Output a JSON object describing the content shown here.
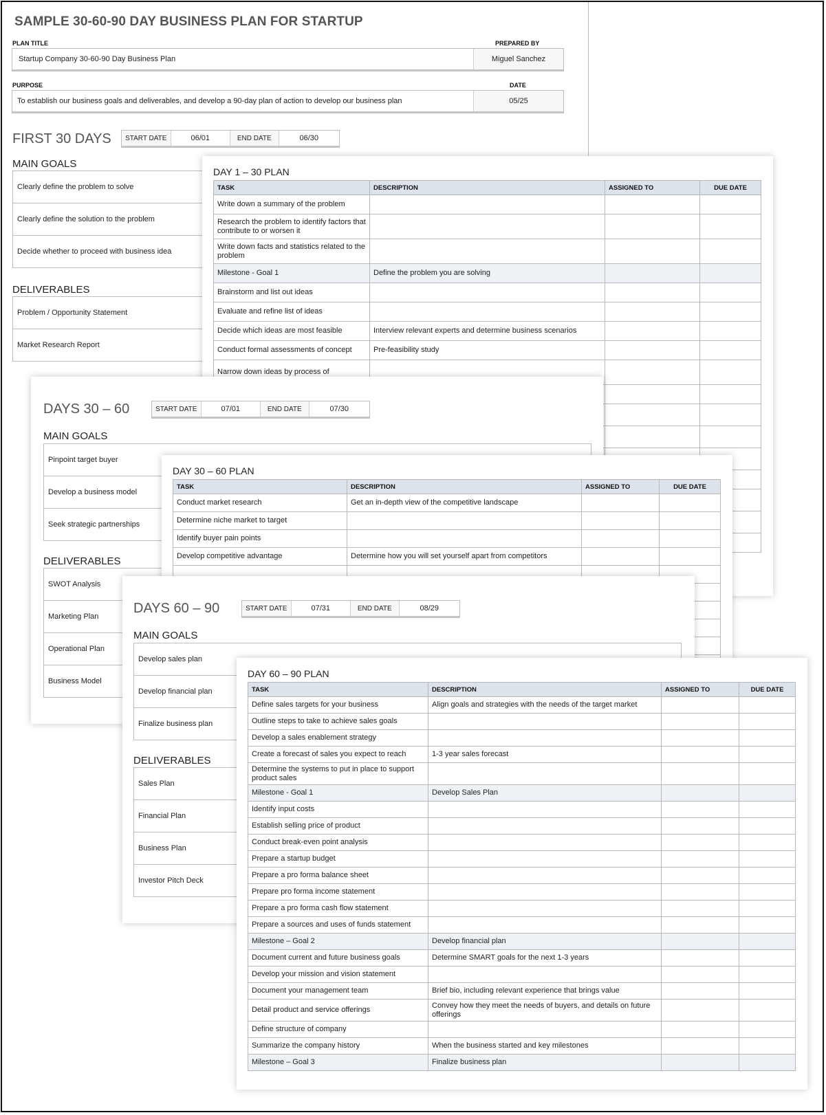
{
  "document": {
    "title": "SAMPLE 30-60-90 DAY BUSINESS PLAN FOR STARTUP",
    "plan_title_label": "PLAN TITLE",
    "plan_title_value": "Startup Company 30-60-90 Day Business Plan",
    "prepared_by_label": "PREPARED BY",
    "prepared_by_value": "Miguel Sanchez",
    "purpose_label": "PURPOSE",
    "purpose_value": "To establish our business goals and deliverables, and develop a 90-day plan of action to develop our business plan",
    "date_label": "DATE",
    "date_value": "05/25"
  },
  "labels": {
    "start_date": "START DATE",
    "end_date": "END DATE",
    "main_goals": "MAIN GOALS",
    "deliverables": "DELIVERABLES",
    "col_task": "TASK",
    "col_description": "DESCRIPTION",
    "col_assigned": "ASSIGNED TO",
    "col_due": "DUE DATE"
  },
  "periods": [
    {
      "title": "FIRST 30 DAYS",
      "start_date": "06/01",
      "end_date": "06/30",
      "main_goals": [
        "Clearly define the problem to solve",
        "Clearly define the solution to the problem",
        "Decide whether to proceed with business idea"
      ],
      "deliverables": [
        "Problem / Opportunity Statement",
        "Market Research Report"
      ],
      "plan_title": "DAY 1 – 30 PLAN",
      "tasks": [
        {
          "task": "Write down a summary of the problem",
          "description": "",
          "assigned_to": "",
          "due_date": "",
          "milestone": false
        },
        {
          "task": "Research the problem to identify factors that contribute to or worsen it",
          "description": "",
          "assigned_to": "",
          "due_date": "",
          "milestone": false
        },
        {
          "task": "Write down facts and statistics related to the problem",
          "description": "",
          "assigned_to": "",
          "due_date": "",
          "milestone": false
        },
        {
          "task": "Milestone - Goal 1",
          "description": "Define the problem you are solving",
          "assigned_to": "",
          "due_date": "",
          "milestone": true
        },
        {
          "task": "Brainstorm and list out ideas",
          "description": "",
          "assigned_to": "",
          "due_date": "",
          "milestone": false
        },
        {
          "task": "Evaluate and refine list of ideas",
          "description": "",
          "assigned_to": "",
          "due_date": "",
          "milestone": false
        },
        {
          "task": "Decide which ideas are most feasible",
          "description": "Interview relevant experts and determine business scenarios",
          "assigned_to": "",
          "due_date": "",
          "milestone": false
        },
        {
          "task": "Conduct formal assessments of concept",
          "description": "Pre-feasibility study",
          "assigned_to": "",
          "due_date": "",
          "milestone": false
        },
        {
          "task": "Narrow down ideas by process of",
          "description": "",
          "assigned_to": "",
          "due_date": "",
          "milestone": false
        }
      ]
    },
    {
      "title": "DAYS 30 – 60",
      "start_date": "07/01",
      "end_date": "07/30",
      "main_goals": [
        "Pinpoint target buyer",
        "Develop a business model",
        "Seek strategic partnerships"
      ],
      "deliverables": [
        "SWOT Analysis",
        "Marketing Plan",
        "Operational Plan",
        "Business Model"
      ],
      "plan_title": "DAY 30 – 60 PLAN",
      "tasks": [
        {
          "task": "Conduct market research",
          "description": "Get an in-depth view of the competitive landscape",
          "assigned_to": "",
          "due_date": "",
          "milestone": false
        },
        {
          "task": "Determine niche market to target",
          "description": "",
          "assigned_to": "",
          "due_date": "",
          "milestone": false
        },
        {
          "task": "Identify buyer pain points",
          "description": "",
          "assigned_to": "",
          "due_date": "",
          "milestone": false
        },
        {
          "task": "Develop competitive advantage",
          "description": "Determine how you will set yourself apart from competitors",
          "assigned_to": "",
          "due_date": "",
          "milestone": false
        }
      ]
    },
    {
      "title": "DAYS 60 – 90",
      "start_date": "07/31",
      "end_date": "08/29",
      "main_goals": [
        "Develop sales plan",
        "Develop financial plan",
        "Finalize business plan"
      ],
      "deliverables": [
        "Sales Plan",
        "Financial Plan",
        "Business Plan",
        "Investor Pitch Deck"
      ],
      "plan_title": "DAY 60 – 90 PLAN",
      "tasks": [
        {
          "task": "Define sales targets for your business",
          "description": "Align goals and strategies with the needs of the target market",
          "assigned_to": "",
          "due_date": "",
          "milestone": false
        },
        {
          "task": "Outline steps to take to achieve sales goals",
          "description": "",
          "assigned_to": "",
          "due_date": "",
          "milestone": false
        },
        {
          "task": "Develop a sales enablement strategy",
          "description": "",
          "assigned_to": "",
          "due_date": "",
          "milestone": false
        },
        {
          "task": "Create a forecast of sales you expect to reach",
          "description": "1-3 year sales forecast",
          "assigned_to": "",
          "due_date": "",
          "milestone": false
        },
        {
          "task": "Determine the systems to put in place to support product sales",
          "description": "",
          "assigned_to": "",
          "due_date": "",
          "milestone": false
        },
        {
          "task": "Milestone - Goal 1",
          "description": "Develop Sales Plan",
          "assigned_to": "",
          "due_date": "",
          "milestone": true
        },
        {
          "task": "Identify input costs",
          "description": "",
          "assigned_to": "",
          "due_date": "",
          "milestone": false
        },
        {
          "task": "Establish selling price of product",
          "description": "",
          "assigned_to": "",
          "due_date": "",
          "milestone": false
        },
        {
          "task": "Conduct break-even point analysis",
          "description": "",
          "assigned_to": "",
          "due_date": "",
          "milestone": false
        },
        {
          "task": "Prepare a startup budget",
          "description": "",
          "assigned_to": "",
          "due_date": "",
          "milestone": false
        },
        {
          "task": "Prepare a pro forma balance sheet",
          "description": "",
          "assigned_to": "",
          "due_date": "",
          "milestone": false
        },
        {
          "task": "Prepare pro forma income statement",
          "description": "",
          "assigned_to": "",
          "due_date": "",
          "milestone": false
        },
        {
          "task": "Prepare a pro forma cash flow statement",
          "description": "",
          "assigned_to": "",
          "due_date": "",
          "milestone": false
        },
        {
          "task": "Prepare a sources and uses of funds statement",
          "description": "",
          "assigned_to": "",
          "due_date": "",
          "milestone": false
        },
        {
          "task": "Milestone – Goal 2",
          "description": "Develop financial plan",
          "assigned_to": "",
          "due_date": "",
          "milestone": true
        },
        {
          "task": "Document current and future business goals",
          "description": "Determine SMART goals for the next 1-3 years",
          "assigned_to": "",
          "due_date": "",
          "milestone": false
        },
        {
          "task": "Develop your mission and vision statement",
          "description": "",
          "assigned_to": "",
          "due_date": "",
          "milestone": false
        },
        {
          "task": "Document your management team",
          "description": "Brief bio, including relevant experience that brings value",
          "assigned_to": "",
          "due_date": "",
          "milestone": false
        },
        {
          "task": "Detail product and service offerings",
          "description": "Convey how they meet the needs of buyers, and details on future offerings",
          "assigned_to": "",
          "due_date": "",
          "milestone": false
        },
        {
          "task": "Define structure of company",
          "description": "",
          "assigned_to": "",
          "due_date": "",
          "milestone": false
        },
        {
          "task": "Summarize the company history",
          "description": "When the business started and key milestones",
          "assigned_to": "",
          "due_date": "",
          "milestone": false
        },
        {
          "task": "Milestone – Goal 3",
          "description": "Finalize business plan",
          "assigned_to": "",
          "due_date": "",
          "milestone": true
        }
      ]
    }
  ],
  "colors": {
    "header_band": "#dde3ea",
    "milestone_row": "#eef1f5",
    "grid_line": "#b8b8b8"
  }
}
